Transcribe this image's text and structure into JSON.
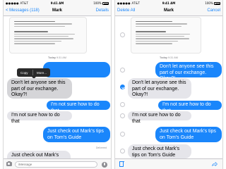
{
  "left": {
    "status": {
      "carrier": "●●●●● AT&T",
      "time": "9:41 AM",
      "battery": "100%"
    },
    "nav": {
      "back": "< Messages (118)",
      "title": "Mark",
      "action": "Details"
    },
    "timestamp_day": "Today",
    "timestamp_time": "9:31 AM",
    "popup": {
      "copy": "Copy",
      "more": "More..."
    },
    "messages": [
      {
        "text": "Don't let anyone see this part of our exchange. Okay?!"
      },
      {
        "text": "I'm not sure how to do that"
      },
      {
        "text": "Just check out Mark's tips on Tom's Guide"
      },
      {
        "text": "I'm not sure how to do that"
      },
      {
        "text": "Just check out Mark's tips on Tom's Guide"
      },
      {
        "text": "Just check out Mark's tips on Tom's Guide"
      }
    ],
    "delivered": "Delivered",
    "input_placeholder": "iMessage",
    "icons": {
      "camera": "camera-icon",
      "mic": "microphone-icon"
    }
  },
  "right": {
    "status": {
      "carrier": "●●●●● AT&T",
      "time": "9:41 AM",
      "battery": "100%"
    },
    "nav": {
      "left": "Delete All",
      "title": "Mark",
      "right": "Cancel"
    },
    "timestamp_day": "Today",
    "timestamp_time": "9:31 AM",
    "messages": [
      {
        "text": "Don't let anyone see this part of our exchange. Okay?!"
      },
      {
        "text": "Don't let anyone see this part of our exchange. Okay?!",
        "selected": true
      },
      {
        "text": "I'm not sure how to do that"
      },
      {
        "text": "I'm not sure how to do that"
      },
      {
        "text": "Just check out Mark's tips on Tom's Guide"
      },
      {
        "text": "Just check out Mark's tips on Tom's Guide"
      }
    ],
    "icons": {
      "trash": "trash-icon",
      "forward": "forward-icon"
    }
  },
  "colors": {
    "accent": "#1a86fb",
    "incoming_bubble": "#e5e5ea",
    "outgoing_bubble": "#1a86fb"
  }
}
